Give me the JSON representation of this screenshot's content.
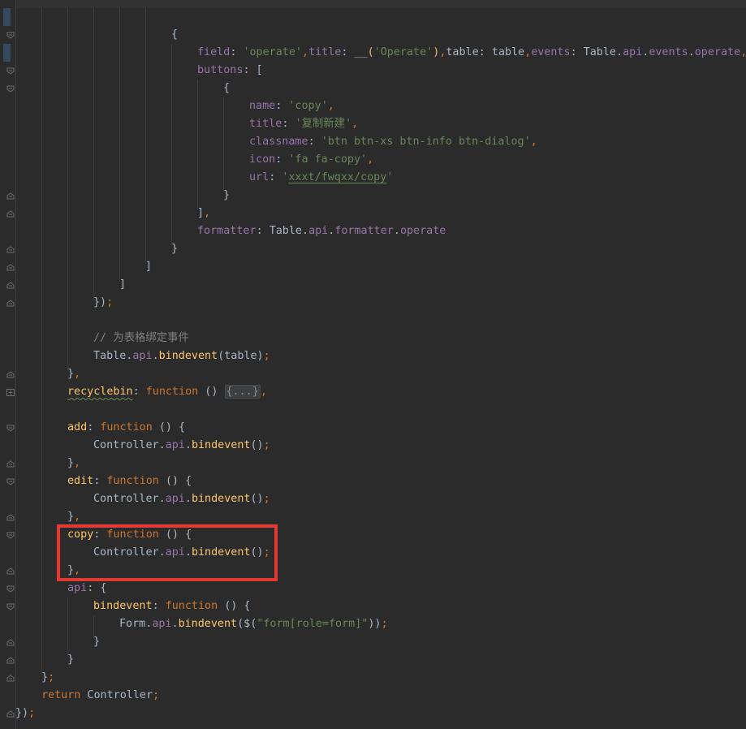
{
  "code": {
    "l1_brace": "{",
    "l2": {
      "field_key": "field",
      "colon": ": ",
      "field_val": "'operate'",
      "comma1": ",",
      "title_key": "title",
      "title_fn": "__",
      "paren_open": "(",
      "title_val": "'Operate'",
      "paren_close": ")",
      "comma2": ",",
      "table_key": "table",
      "table_val": "table",
      "comma3": ",",
      "events_key": "events",
      "events_val_a": "Table.",
      "events_val_api": "api",
      "events_val_dot": ".",
      "events_val_b": "events",
      "events_val_c": ".",
      "events_val_d": "operate",
      "comma4": ","
    },
    "l3": {
      "key": "buttons",
      "rest": ": ["
    },
    "l4_brace": "{",
    "l5": {
      "key": "name",
      "colon": ": ",
      "val": "'copy'",
      "comma": ","
    },
    "l6": {
      "key": "title",
      "colon": ": ",
      "val": "'复制新建'",
      "comma": ","
    },
    "l7": {
      "key": "classname",
      "colon": ": ",
      "val": "'btn btn-xs btn-info btn-dialog'",
      "comma": ","
    },
    "l8": {
      "key": "icon",
      "colon": ": ",
      "val": "'fa fa-copy'",
      "comma": ","
    },
    "l9": {
      "key": "url",
      "colon": ": ",
      "q1": "'",
      "val": "xxxt/fwqxx/copy",
      "q2": "'"
    },
    "l10_brace": "}",
    "l11": {
      "bracket": "]",
      "comma": ","
    },
    "l12": {
      "key": "formatter",
      "colon": ": ",
      "a": "Table.",
      "api": "api",
      "dot": ".",
      "b": "formatter",
      "dot2": ".",
      "c": "operate"
    },
    "l13_brace": "}",
    "l14_bracket": "]",
    "l15_bracket": "]",
    "l16": {
      "a": "})",
      "semi": ";"
    },
    "l17_comment": "// 为表格绑定事件",
    "l18": {
      "a": "Table.",
      "api": "api",
      "dot": ".",
      "fn": "bindevent",
      "args": "(table)",
      "semi": ";"
    },
    "l19": {
      "brace": "}",
      "comma": ","
    },
    "l20": {
      "key": "recyclebin",
      "colon": ": ",
      "kw": "function",
      "paren": " () ",
      "folded": "{...}",
      "comma": ","
    },
    "l22": {
      "key": "add",
      "colon": ": ",
      "kw": "function",
      "rest": " () {"
    },
    "l23": {
      "a": "Controller.",
      "api": "api",
      "dot": ".",
      "fn": "bindevent",
      "args": "()",
      "semi": ";"
    },
    "l24": {
      "brace": "}",
      "comma": ","
    },
    "l25": {
      "key": "edit",
      "colon": ": ",
      "kw": "function",
      "rest": " () {"
    },
    "l26": {
      "a": "Controller.",
      "api": "api",
      "dot": ".",
      "fn": "bindevent",
      "args": "()",
      "semi": ";"
    },
    "l27": {
      "brace": "}",
      "comma": ","
    },
    "l28": {
      "key": "copy",
      "colon": ": ",
      "kw": "function",
      "rest": " () {"
    },
    "l29": {
      "a": "Controller.",
      "api": "api",
      "dot": ".",
      "fn": "bindevent",
      "args": "()",
      "semi": ";"
    },
    "l30": {
      "brace": "}",
      "comma": ","
    },
    "l31": {
      "key": "api",
      "colon": ": ",
      "rest": "{"
    },
    "l32": {
      "key": "bindevent",
      "colon": ": ",
      "kw": "function",
      "rest": " () {"
    },
    "l33": {
      "a": "Form.",
      "api": "api",
      "dot": ".",
      "fn": "bindevent",
      "p1": "($(",
      "str": "\"form[role=form]\"",
      "p2": "))",
      "semi": ";"
    },
    "l34_brace": "}",
    "l35_brace": "}",
    "l36": {
      "brace": "}",
      "semi": ";"
    },
    "l37": {
      "kw": "return",
      "val": " Controller",
      "semi": ";"
    },
    "l38": {
      "a": "})",
      "semi": ";"
    }
  },
  "colors": {
    "highlight": "#e53935",
    "background": "#2b2b2b",
    "keyword": "#cc7832",
    "property": "#9876aa",
    "string": "#6a8759",
    "function": "#ffc66d"
  }
}
